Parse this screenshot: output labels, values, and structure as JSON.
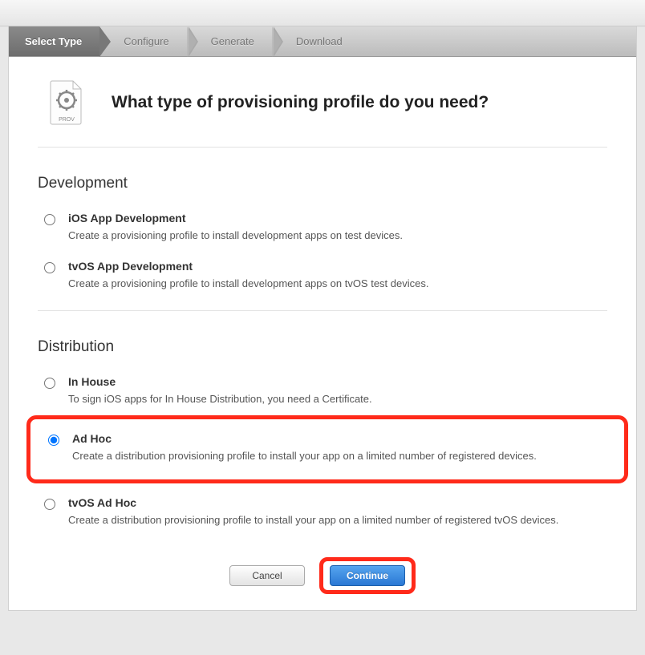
{
  "breadcrumb": {
    "step1": "Select Type",
    "step2": "Configure",
    "step3": "Generate",
    "step4": "Download"
  },
  "header": {
    "title": "What type of provisioning profile do you need?",
    "icon_label": "PROV"
  },
  "sections": {
    "development": {
      "heading": "Development",
      "opt1": {
        "title": "iOS App Development",
        "desc": "Create a provisioning profile to install development apps on test devices."
      },
      "opt2": {
        "title": "tvOS App Development",
        "desc": "Create a provisioning profile to install development apps on tvOS test devices."
      }
    },
    "distribution": {
      "heading": "Distribution",
      "opt1": {
        "title": "In House",
        "desc": "To sign iOS apps for In House Distribution, you need a Certificate."
      },
      "opt2": {
        "title": "Ad Hoc",
        "desc": "Create a distribution provisioning profile to install your app on a limited number of registered devices."
      },
      "opt3": {
        "title": "tvOS Ad Hoc",
        "desc": "Create a distribution provisioning profile to install your app on a limited number of registered tvOS devices."
      }
    }
  },
  "footer": {
    "cancel": "Cancel",
    "continue": "Continue"
  },
  "selected_option": "adhoc",
  "colors": {
    "highlight": "#ff2a1a",
    "primary_button": "#2a78d4"
  }
}
